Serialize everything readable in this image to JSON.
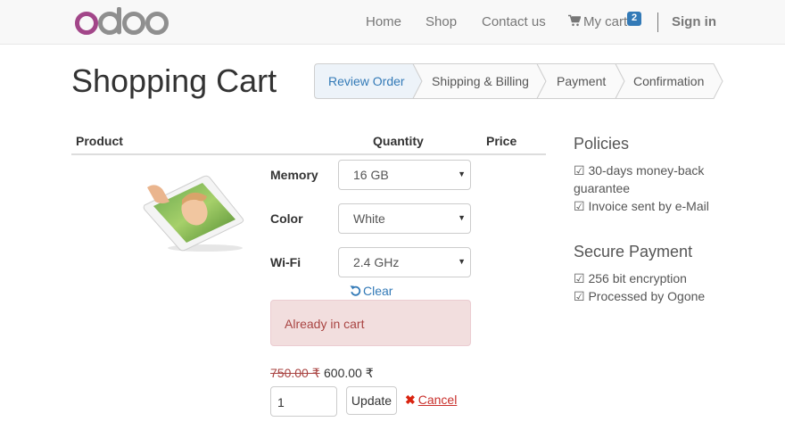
{
  "brand": {
    "name": "odoo",
    "color": "#a24689"
  },
  "nav": {
    "home": "Home",
    "shop": "Shop",
    "contact": "Contact us",
    "cart": "My cart",
    "cart_count": "2",
    "signin": "Sign in"
  },
  "page": {
    "title": "Shopping Cart"
  },
  "wizard": {
    "steps": [
      {
        "label": "Review Order",
        "active": true
      },
      {
        "label": "Shipping & Billing",
        "active": false
      },
      {
        "label": "Payment",
        "active": false
      },
      {
        "label": "Confirmation",
        "active": false
      }
    ]
  },
  "table": {
    "headers": {
      "product": "Product",
      "quantity": "Quantity",
      "price": "Price"
    }
  },
  "product": {
    "image_icon": "ipad-product-image",
    "attributes": [
      {
        "label": "Memory",
        "value": "16 GB"
      },
      {
        "label": "Color",
        "value": "White"
      },
      {
        "label": "Wi-Fi",
        "value": "2.4 GHz"
      }
    ],
    "clear_label": "Clear",
    "alert": "Already in cart",
    "old_price": "750.00 ₹",
    "new_price": "600.00 ₹",
    "quantity": "1",
    "update_label": "Update",
    "cancel_label": "Cancel"
  },
  "sidebar": {
    "policies": {
      "heading": "Policies",
      "items": [
        "☑ 30-days money-back guarantee",
        "☑ Invoice sent by e-Mail"
      ]
    },
    "secure_payment": {
      "heading": "Secure Payment",
      "items": [
        "☑ 256 bit encryption",
        "☑ Processed by Ogone"
      ]
    }
  },
  "colors": {
    "link": "#337ab7",
    "alert_bg": "#f2dede",
    "alert_text": "#a94442",
    "active_step_bg": "#edf3f9"
  }
}
